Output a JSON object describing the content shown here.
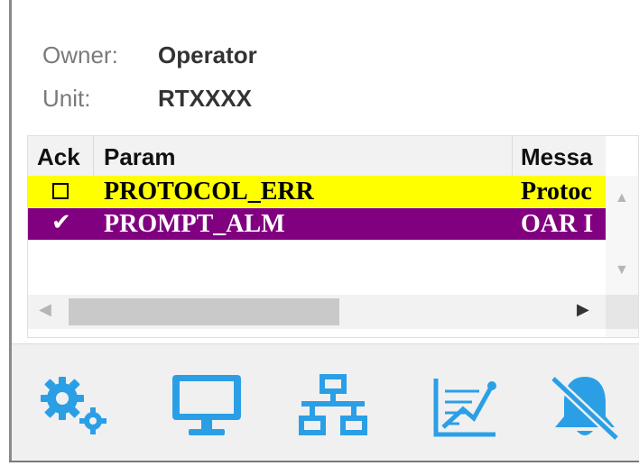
{
  "info": {
    "owner_label": "Owner:",
    "owner_value": "Operator",
    "unit_label": "Unit:",
    "unit_value": "RTXXXX"
  },
  "grid": {
    "columns": [
      "Ack",
      "Param",
      "Messa"
    ],
    "rows": [
      {
        "ack": "unchecked",
        "param": "PROTOCOL_ERR",
        "message": "Protoc",
        "bg": "#ffff00",
        "fg": "#000000"
      },
      {
        "ack": "checked",
        "param": "PROMPT_ALM",
        "message": "OAR I",
        "bg": "#800080",
        "fg": "#ffffff"
      }
    ],
    "checkmark": "✔"
  },
  "toolbar": {
    "accent": "#2b9fe6",
    "items": [
      {
        "icon": "gears-icon"
      },
      {
        "icon": "monitor-icon"
      },
      {
        "icon": "network-icon"
      },
      {
        "icon": "trend-chart-icon"
      },
      {
        "icon": "bell-muted-icon"
      }
    ]
  }
}
